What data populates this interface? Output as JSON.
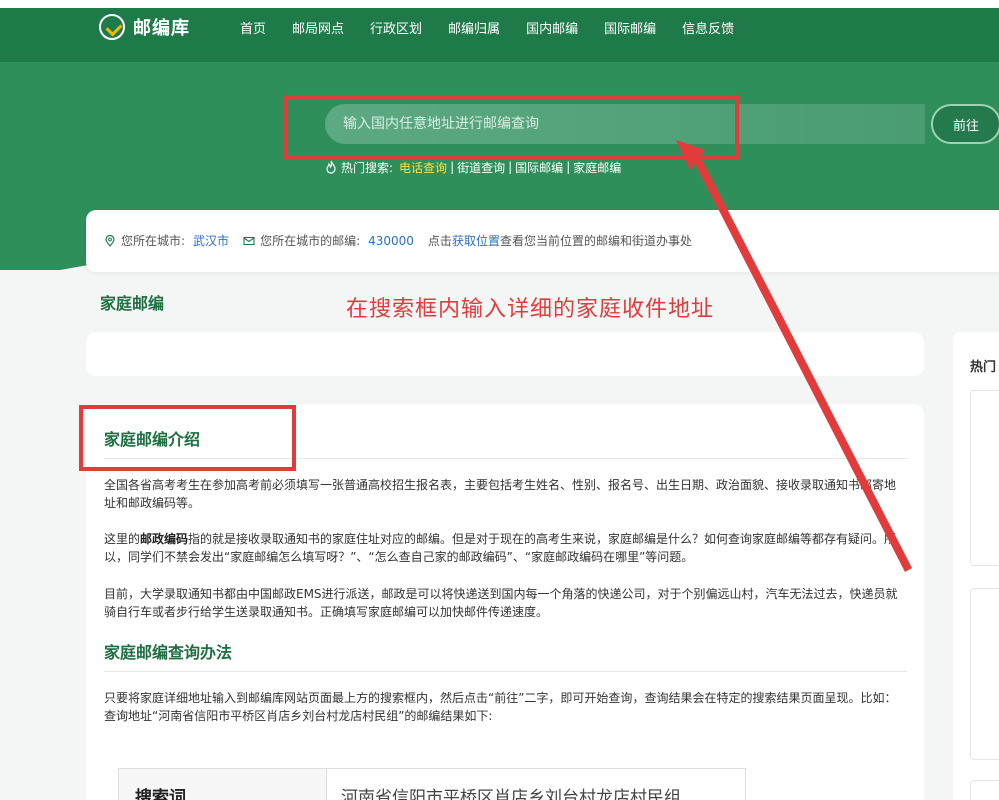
{
  "brand": {
    "name": "邮编库"
  },
  "nav": [
    "首页",
    "邮局网点",
    "行政区划",
    "邮编归属",
    "国内邮编",
    "国际邮编",
    "信息反馈"
  ],
  "search": {
    "placeholder": "输入国内任意地址进行邮编查询",
    "button": "前往"
  },
  "hot_search": {
    "label": "热门搜索:",
    "items": [
      "电话查询",
      "街道查询",
      "国际邮编",
      "家庭邮编"
    ],
    "separator": "|"
  },
  "location": {
    "city_label": "您所在城市:",
    "city": "武汉市",
    "postcode_label": "您所在城市的邮编:",
    "postcode": "430000",
    "hint_prefix": "点击",
    "hint_link": "获取位置",
    "hint_suffix": "查看您当前位置的邮编和街道办事处"
  },
  "section_title": "家庭邮编",
  "annotation": "在搜索框内输入详细的家庭收件地址",
  "sidebar": {
    "title": "热门"
  },
  "article": {
    "h1": "家庭邮编介绍",
    "p1": "全国各省高考考生在参加高考前必须填写一张普通高校招生报名表，主要包括考生姓名、性别、报名号、出生日期、政治面貌、接收录取通知书邮寄地址和邮政编码等。",
    "p2_bold": "邮政编码",
    "p2_a": "这里的",
    "p2_b": "指的就是接收录取通知书的家庭住址对应的邮编。但是对于现在的高考生来说，家庭邮编是什么？如何查询家庭邮编等都存有疑问。所以，同学们不禁会发出“家庭邮编怎么填写呀？”、“怎么查自己家的邮政编码”、“家庭邮政编码在哪里”等问题。",
    "p3": "目前，大学录取通知书都由中国邮政EMS进行派送，邮政是可以将快递送到国内每一个角落的快递公司，对于个别偏远山村，汽车无法过去，快递员就骑自行车或者步行给学生送录取通知书。正确填写家庭邮编可以加快邮件传递速度。",
    "h2": "家庭邮编查询办法",
    "p4": "只要将家庭详细地址输入到邮编库网站页面最上方的搜索框内，然后点击“前往”二字，即可开始查询，查询结果会在特定的搜索结果页面呈现。比如：查询地址“河南省信阳市平桥区肖店乡刘台村龙店村民组”的邮编结果如下:",
    "table": {
      "key": "搜索词",
      "value": "河南省信阳市平桥区肖店乡刘台村龙店村民组"
    }
  },
  "colors": {
    "brand_green": "#1f7a4a",
    "hero_green": "#2e8f5a",
    "annotation_red": "#e23b3b",
    "link_blue": "#2d6ec9",
    "highlight_yellow": "#f5e24a"
  }
}
